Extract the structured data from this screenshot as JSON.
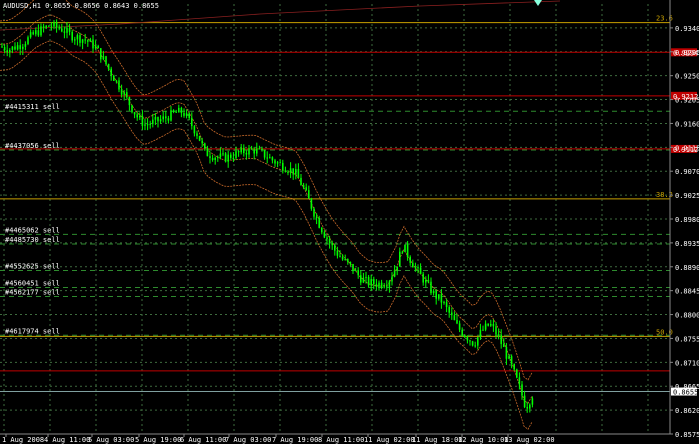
{
  "header": {
    "symbol_text": "AUDUSD,H1  0.8655 0.8656 0.8643 0.8655"
  },
  "colors": {
    "background": "#000000",
    "grid": "#3e6b3e",
    "bull_candle": "#00ff00",
    "bear_candle": "#00ff00",
    "fib_line": "#c8a000",
    "red_line": "#c00000",
    "order_line": "#2e8b2e",
    "bollinger": "#c96a2a",
    "price_line": "#7f9f9f"
  },
  "chart_data": {
    "type": "candlestick",
    "symbol": "AUDUSD",
    "timeframe": "H1",
    "ohlc_text": "0.8655 0.8656 0.8643 0.8655",
    "ylim": [
      0.8575,
      0.9385
    ],
    "y_ticks": [
      "0.9340",
      "0.9295",
      "0.9250",
      "0.9205",
      "0.9160",
      "0.9115",
      "0.9070",
      "0.9025",
      "0.8980",
      "0.8935",
      "0.8890",
      "0.8845",
      "0.8800",
      "0.8755",
      "0.8710",
      "0.8665",
      "0.8620",
      "0.8575"
    ],
    "x_ticks": [
      "1 Aug 2008",
      "4 Aug 11:00",
      "5 Aug 03:00",
      "5 Aug 19:00",
      "6 Aug 11:00",
      "7 Aug 03:00",
      "7 Aug 19:00",
      "8 Aug 11:00",
      "11 Aug 02:00",
      "11 Aug 18:00",
      "12 Aug 10:00",
      "13 Aug 02:00"
    ],
    "current_price_label": "0.8655",
    "horizontal_levels": [
      {
        "kind": "fib",
        "price": 0.935,
        "label": "23.6"
      },
      {
        "kind": "red",
        "price": 0.9294,
        "label": "0.9294"
      },
      {
        "kind": "red",
        "price": 0.9212,
        "label": "0.9212"
      },
      {
        "kind": "red",
        "price": 0.9112,
        "label": "0.9112"
      },
      {
        "kind": "fib",
        "price": 0.9018,
        "label": "38.2"
      },
      {
        "kind": "fib",
        "price": 0.8759,
        "label": "50.0"
      },
      {
        "kind": "red",
        "price": 0.8694,
        "label": ""
      }
    ],
    "orders": [
      {
        "label": "#4415311 sell",
        "price": 0.9183
      },
      {
        "label": "#4437056 sell",
        "price": 0.911
      },
      {
        "label": "#4465062 sell",
        "price": 0.8951
      },
      {
        "label": "#4485730 sell",
        "price": 0.8933
      },
      {
        "label": "#4552625 sell",
        "price": 0.8883
      },
      {
        "label": "#4560451 sell",
        "price": 0.8851
      },
      {
        "label": "#4562177 sell",
        "price": 0.8834
      },
      {
        "label": "#4617974 sell",
        "price": 0.8761
      }
    ],
    "close_path": [
      [
        0,
        0.9305
      ],
      [
        10,
        0.93
      ],
      [
        22,
        0.931
      ],
      [
        35,
        0.933
      ],
      [
        50,
        0.9345
      ],
      [
        62,
        0.9338
      ],
      [
        72,
        0.9325
      ],
      [
        85,
        0.9318
      ],
      [
        95,
        0.9305
      ],
      [
        103,
        0.9282
      ],
      [
        112,
        0.9252
      ],
      [
        122,
        0.9222
      ],
      [
        130,
        0.9195
      ],
      [
        138,
        0.917
      ],
      [
        145,
        0.9158
      ],
      [
        155,
        0.9163
      ],
      [
        165,
        0.917
      ],
      [
        175,
        0.918
      ],
      [
        183,
        0.9182
      ],
      [
        190,
        0.9162
      ],
      [
        198,
        0.9138
      ],
      [
        205,
        0.9105
      ],
      [
        215,
        0.9098
      ],
      [
        225,
        0.9095
      ],
      [
        235,
        0.9102
      ],
      [
        245,
        0.9108
      ],
      [
        255,
        0.911
      ],
      [
        265,
        0.91
      ],
      [
        275,
        0.9088
      ],
      [
        285,
        0.9078
      ],
      [
        295,
        0.9068
      ],
      [
        303,
        0.904
      ],
      [
        310,
        0.901
      ],
      [
        318,
        0.8975
      ],
      [
        325,
        0.895
      ],
      [
        333,
        0.8925
      ],
      [
        342,
        0.8905
      ],
      [
        352,
        0.8888
      ],
      [
        360,
        0.887
      ],
      [
        368,
        0.886
      ],
      [
        378,
        0.8858
      ],
      [
        388,
        0.8862
      ],
      [
        396,
        0.889
      ],
      [
        403,
        0.893
      ],
      [
        410,
        0.8905
      ],
      [
        418,
        0.888
      ],
      [
        426,
        0.886
      ],
      [
        434,
        0.8838
      ],
      [
        442,
        0.8825
      ],
      [
        450,
        0.88
      ],
      [
        458,
        0.8775
      ],
      [
        466,
        0.876
      ],
      [
        474,
        0.8745
      ],
      [
        482,
        0.877
      ],
      [
        490,
        0.8782
      ],
      [
        498,
        0.876
      ],
      [
        505,
        0.873
      ],
      [
        512,
        0.87
      ],
      [
        518,
        0.867
      ],
      [
        522,
        0.8648
      ],
      [
        526,
        0.8625
      ],
      [
        530,
        0.864
      ],
      [
        534,
        0.8655
      ]
    ]
  }
}
